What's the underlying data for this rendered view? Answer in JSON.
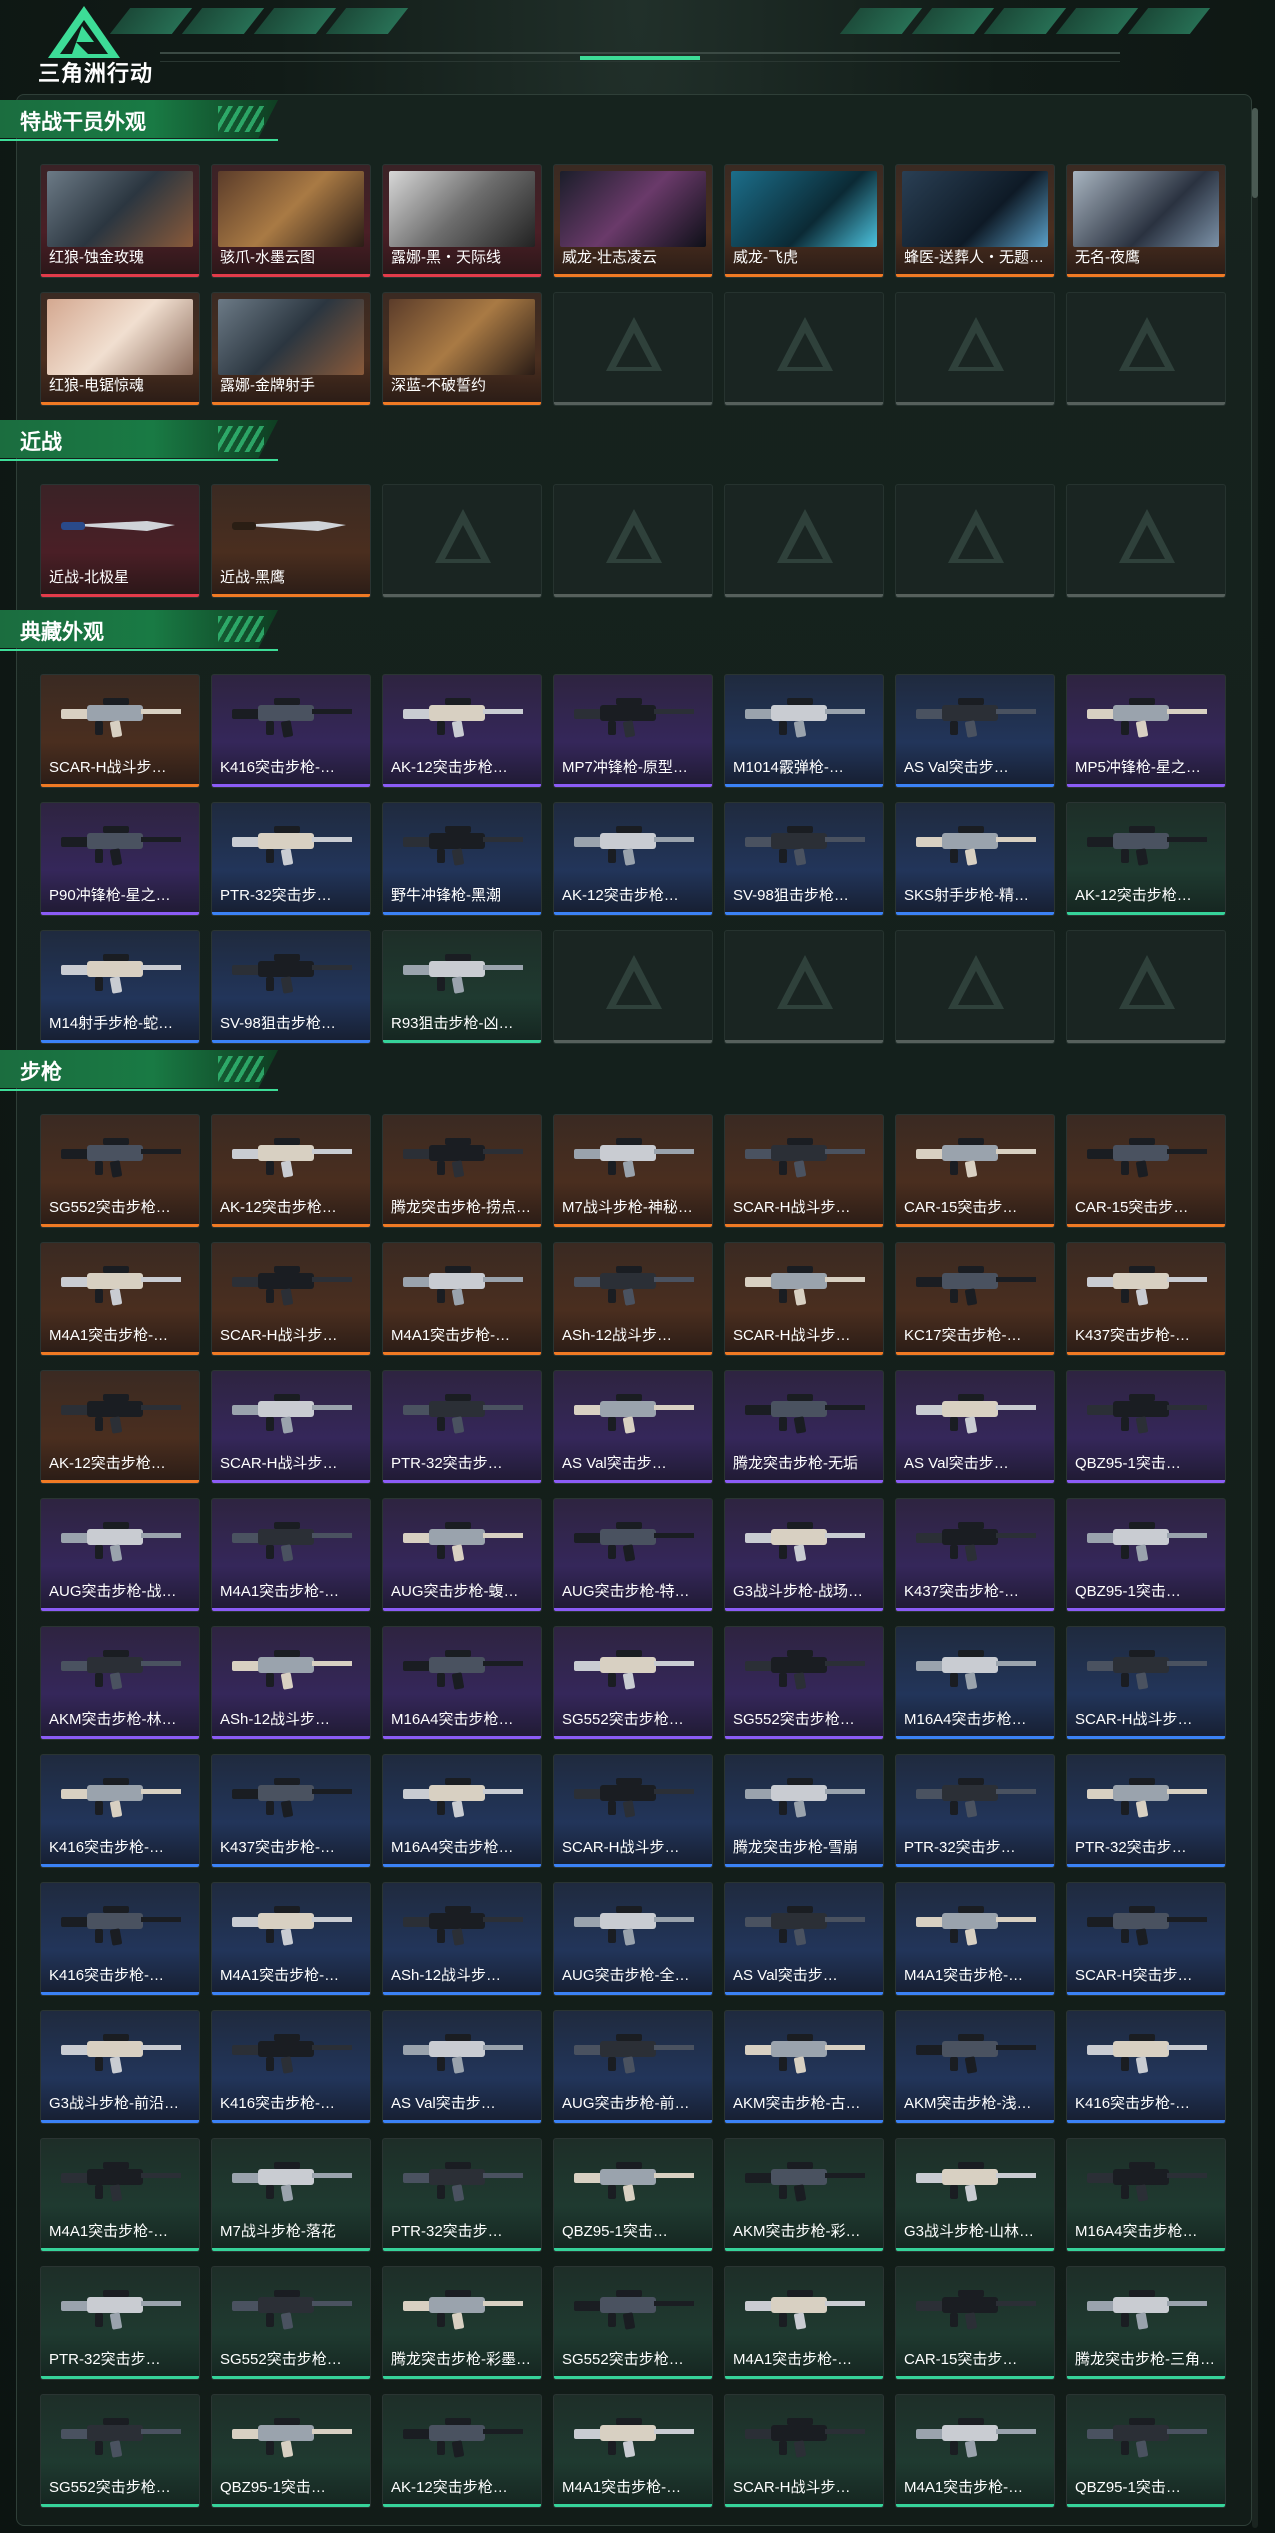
{
  "app": {
    "title": "三角洲行动"
  },
  "sections": [
    {
      "key": "operators",
      "title": "特战干员外观",
      "items": [
        {
          "name": "红狼-蚀金玫瑰",
          "rarity": "red",
          "kind": "operator"
        },
        {
          "name": "骇爪-水墨云图",
          "rarity": "red",
          "kind": "operator"
        },
        {
          "name": "露娜-黑・天际线",
          "rarity": "red",
          "kind": "operator"
        },
        {
          "name": "威龙-壮志凌云",
          "rarity": "orange",
          "kind": "operator"
        },
        {
          "name": "威龙-飞虎",
          "rarity": "orange",
          "kind": "operator"
        },
        {
          "name": "蜂医-送葬人・无题…",
          "rarity": "orange",
          "kind": "operator"
        },
        {
          "name": "无名-夜鹰",
          "rarity": "orange",
          "kind": "operator"
        },
        {
          "name": "红狼-电锯惊魂",
          "rarity": "orange",
          "kind": "operator"
        },
        {
          "name": "露娜-金牌射手",
          "rarity": "orange",
          "kind": "operator"
        },
        {
          "name": "深蓝-不破誓约",
          "rarity": "orange",
          "kind": "operator"
        },
        {
          "name": "",
          "rarity": "empty"
        },
        {
          "name": "",
          "rarity": "empty"
        },
        {
          "name": "",
          "rarity": "empty"
        },
        {
          "name": "",
          "rarity": "empty"
        }
      ]
    },
    {
      "key": "melee",
      "title": "近战",
      "items": [
        {
          "name": "近战-北极星",
          "rarity": "red",
          "kind": "knife"
        },
        {
          "name": "近战-黑鹰",
          "rarity": "orange",
          "kind": "knife"
        },
        {
          "name": "",
          "rarity": "empty"
        },
        {
          "name": "",
          "rarity": "empty"
        },
        {
          "name": "",
          "rarity": "empty"
        },
        {
          "name": "",
          "rarity": "empty"
        },
        {
          "name": "",
          "rarity": "empty"
        }
      ]
    },
    {
      "key": "collection",
      "title": "典藏外观",
      "items": [
        {
          "name": "SCAR-H战斗步…",
          "rarity": "orange"
        },
        {
          "name": "K416突击步枪-…",
          "rarity": "purple"
        },
        {
          "name": "AK-12突击步枪…",
          "rarity": "purple"
        },
        {
          "name": "MP7冲锋枪-原型…",
          "rarity": "purple"
        },
        {
          "name": "M1014霰弹枪-…",
          "rarity": "blue"
        },
        {
          "name": "AS Val突击步…",
          "rarity": "blue"
        },
        {
          "name": "MP5冲锋枪-星之…",
          "rarity": "purple"
        },
        {
          "name": "P90冲锋枪-星之…",
          "rarity": "purple"
        },
        {
          "name": "PTR-32突击步…",
          "rarity": "blue"
        },
        {
          "name": "野牛冲锋枪-黑潮",
          "rarity": "blue"
        },
        {
          "name": "AK-12突击步枪…",
          "rarity": "blue"
        },
        {
          "name": "SV-98狙击步枪…",
          "rarity": "blue"
        },
        {
          "name": "SKS射手步枪-精…",
          "rarity": "blue"
        },
        {
          "name": "AK-12突击步枪…",
          "rarity": "green"
        },
        {
          "name": "M14射手步枪-蛇…",
          "rarity": "blue"
        },
        {
          "name": "SV-98狙击步枪…",
          "rarity": "blue"
        },
        {
          "name": "R93狙击步枪-凶…",
          "rarity": "green"
        },
        {
          "name": "",
          "rarity": "empty"
        },
        {
          "name": "",
          "rarity": "empty"
        },
        {
          "name": "",
          "rarity": "empty"
        },
        {
          "name": "",
          "rarity": "empty"
        }
      ]
    },
    {
      "key": "rifles",
      "title": "步枪",
      "items": [
        {
          "name": "SG552突击步枪…",
          "rarity": "orange"
        },
        {
          "name": "AK-12突击步枪…",
          "rarity": "orange"
        },
        {
          "name": "腾龙突击步枪-捞点…",
          "rarity": "orange"
        },
        {
          "name": "M7战斗步枪-神秘…",
          "rarity": "orange"
        },
        {
          "name": "SCAR-H战斗步…",
          "rarity": "orange"
        },
        {
          "name": "CAR-15突击步…",
          "rarity": "orange"
        },
        {
          "name": "CAR-15突击步…",
          "rarity": "orange"
        },
        {
          "name": "M4A1突击步枪-…",
          "rarity": "orange"
        },
        {
          "name": "SCAR-H战斗步…",
          "rarity": "orange"
        },
        {
          "name": "M4A1突击步枪-…",
          "rarity": "orange"
        },
        {
          "name": "ASh-12战斗步…",
          "rarity": "orange"
        },
        {
          "name": "SCAR-H战斗步…",
          "rarity": "orange"
        },
        {
          "name": "KC17突击步枪-…",
          "rarity": "orange"
        },
        {
          "name": "K437突击步枪-…",
          "rarity": "orange"
        },
        {
          "name": "AK-12突击步枪…",
          "rarity": "orange"
        },
        {
          "name": "SCAR-H战斗步…",
          "rarity": "purple"
        },
        {
          "name": "PTR-32突击步…",
          "rarity": "purple"
        },
        {
          "name": "AS Val突击步…",
          "rarity": "purple"
        },
        {
          "name": "腾龙突击步枪-无垢",
          "rarity": "purple"
        },
        {
          "name": "AS Val突击步…",
          "rarity": "purple"
        },
        {
          "name": "QBZ95-1突击…",
          "rarity": "purple"
        },
        {
          "name": "AUG突击步枪-战…",
          "rarity": "purple"
        },
        {
          "name": "M4A1突击步枪-…",
          "rarity": "purple"
        },
        {
          "name": "AUG突击步枪-蝮…",
          "rarity": "purple"
        },
        {
          "name": "AUG突击步枪-特…",
          "rarity": "purple"
        },
        {
          "name": "G3战斗步枪-战场…",
          "rarity": "purple"
        },
        {
          "name": "K437突击步枪-…",
          "rarity": "purple"
        },
        {
          "name": "QBZ95-1突击…",
          "rarity": "purple"
        },
        {
          "name": "AKM突击步枪-林…",
          "rarity": "purple"
        },
        {
          "name": "ASh-12战斗步…",
          "rarity": "purple"
        },
        {
          "name": "M16A4突击步枪…",
          "rarity": "purple"
        },
        {
          "name": "SG552突击步枪…",
          "rarity": "purple"
        },
        {
          "name": "SG552突击步枪…",
          "rarity": "purple"
        },
        {
          "name": "M16A4突击步枪…",
          "rarity": "blue"
        },
        {
          "name": "SCAR-H战斗步…",
          "rarity": "blue"
        },
        {
          "name": "K416突击步枪-…",
          "rarity": "blue"
        },
        {
          "name": "K437突击步枪-…",
          "rarity": "blue"
        },
        {
          "name": "M16A4突击步枪…",
          "rarity": "blue"
        },
        {
          "name": "SCAR-H战斗步…",
          "rarity": "blue"
        },
        {
          "name": "腾龙突击步枪-雪崩",
          "rarity": "blue"
        },
        {
          "name": "PTR-32突击步…",
          "rarity": "blue"
        },
        {
          "name": "PTR-32突击步…",
          "rarity": "blue"
        },
        {
          "name": "K416突击步枪-…",
          "rarity": "blue"
        },
        {
          "name": "M4A1突击步枪-…",
          "rarity": "blue"
        },
        {
          "name": "ASh-12战斗步…",
          "rarity": "blue"
        },
        {
          "name": "AUG突击步枪-全…",
          "rarity": "blue"
        },
        {
          "name": "AS Val突击步…",
          "rarity": "blue"
        },
        {
          "name": "M4A1突击步枪-…",
          "rarity": "blue"
        },
        {
          "name": "SCAR-H突击步…",
          "rarity": "blue"
        },
        {
          "name": "G3战斗步枪-前沿…",
          "rarity": "blue"
        },
        {
          "name": "K416突击步枪-…",
          "rarity": "blue"
        },
        {
          "name": "AS Val突击步…",
          "rarity": "blue"
        },
        {
          "name": "AUG突击步枪-前…",
          "rarity": "blue"
        },
        {
          "name": "AKM突击步枪-古…",
          "rarity": "blue"
        },
        {
          "name": "AKM突击步枪-浅…",
          "rarity": "blue"
        },
        {
          "name": "K416突击步枪-…",
          "rarity": "blue"
        },
        {
          "name": "M4A1突击步枪-…",
          "rarity": "green"
        },
        {
          "name": "M7战斗步枪-落花",
          "rarity": "green"
        },
        {
          "name": "PTR-32突击步…",
          "rarity": "green"
        },
        {
          "name": "QBZ95-1突击…",
          "rarity": "green"
        },
        {
          "name": "AKM突击步枪-彩…",
          "rarity": "green"
        },
        {
          "name": "G3战斗步枪-山林…",
          "rarity": "green"
        },
        {
          "name": "M16A4突击步枪…",
          "rarity": "green"
        },
        {
          "name": "PTR-32突击步…",
          "rarity": "green"
        },
        {
          "name": "SG552突击步枪…",
          "rarity": "green"
        },
        {
          "name": "腾龙突击步枪-彩墨…",
          "rarity": "green"
        },
        {
          "name": "SG552突击步枪…",
          "rarity": "green"
        },
        {
          "name": "M4A1突击步枪-…",
          "rarity": "green"
        },
        {
          "name": "CAR-15突击步…",
          "rarity": "green"
        },
        {
          "name": "腾龙突击步枪-三角…",
          "rarity": "green"
        },
        {
          "name": "SG552突击步枪…",
          "rarity": "green"
        },
        {
          "name": "QBZ95-1突击…",
          "rarity": "green"
        },
        {
          "name": "AK-12突击步枪…",
          "rarity": "green"
        },
        {
          "name": "M4A1突击步枪-…",
          "rarity": "green"
        },
        {
          "name": "SCAR-H战斗步…",
          "rarity": "green"
        },
        {
          "name": "M4A1突击步枪-…",
          "rarity": "green"
        },
        {
          "name": "QBZ95-1突击…",
          "rarity": "green"
        }
      ]
    }
  ],
  "colors": {
    "accent": "#3ddc97",
    "red": "#e33b4a",
    "orange": "#f07a24",
    "purple": "#8b5cf6",
    "blue": "#3b82f6",
    "green": "#36d39a"
  }
}
